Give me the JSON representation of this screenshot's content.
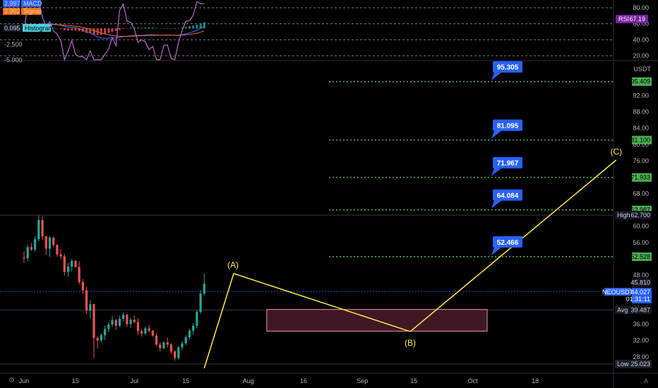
{
  "chart_data": {
    "type": "candlestick",
    "symbol": "NEOUSDT",
    "currency": "USDT",
    "price_axis": {
      "ylim": [
        25.2,
        100.2
      ],
      "ticks": [
        28,
        32,
        36,
        40,
        44,
        48,
        52,
        56,
        60,
        64,
        68,
        72,
        76,
        80,
        84,
        88,
        92
      ]
    },
    "x_axis": {
      "labels": [
        "Jun",
        "15",
        "Jul",
        "15",
        "Aug",
        "16",
        "Sep",
        "15",
        "Oct",
        "18"
      ],
      "label_days": [
        0,
        14,
        30,
        44,
        61,
        76,
        92,
        106,
        122,
        139
      ],
      "xlim": [
        -1,
        173
      ]
    },
    "candles": [
      [
        52.3,
        53.8,
        51.0,
        52.1
      ],
      [
        52.1,
        55.5,
        51.4,
        54.9
      ],
      [
        54.9,
        55.9,
        53.9,
        54.3
      ],
      [
        54.3,
        57.5,
        53.7,
        56.8
      ],
      [
        56.8,
        62.6,
        56.3,
        61.5
      ],
      [
        61.5,
        62.4,
        56.7,
        57.5
      ],
      [
        57.5,
        57.7,
        53.0,
        54.5
      ],
      [
        54.5,
        57.6,
        52.5,
        57.2
      ],
      [
        57.2,
        57.4,
        54.9,
        55.4
      ],
      [
        55.4,
        55.6,
        52.5,
        53.1
      ],
      [
        53.1,
        54.4,
        51.9,
        52.6
      ],
      [
        52.6,
        53.2,
        47.9,
        48.8
      ],
      [
        48.8,
        51.0,
        47.6,
        50.1
      ],
      [
        50.1,
        52.0,
        48.9,
        51.5
      ],
      [
        51.5,
        51.7,
        49.9,
        50.0
      ],
      [
        50.0,
        51.4,
        45.7,
        46.3
      ],
      [
        46.3,
        47.0,
        43.4,
        44.3
      ],
      [
        44.3,
        45.1,
        38.5,
        39.3
      ],
      [
        39.3,
        41.9,
        37.4,
        40.9
      ],
      [
        40.9,
        41.0,
        27.7,
        32.6
      ],
      [
        32.6,
        33.0,
        30.0,
        32.0
      ],
      [
        32.0,
        33.7,
        31.5,
        33.3
      ],
      [
        33.3,
        35.7,
        32.1,
        34.8
      ],
      [
        34.8,
        36.5,
        34.0,
        35.9
      ],
      [
        35.9,
        38.0,
        35.3,
        37.0
      ],
      [
        37.0,
        37.3,
        34.6,
        35.6
      ],
      [
        35.6,
        38.1,
        35.3,
        37.3
      ],
      [
        37.3,
        38.8,
        36.6,
        38.3
      ],
      [
        38.3,
        38.5,
        35.3,
        36.0
      ],
      [
        36.0,
        37.6,
        35.1,
        37.1
      ],
      [
        37.1,
        38.1,
        36.2,
        36.5
      ],
      [
        36.5,
        37.5,
        33.4,
        34.3
      ],
      [
        34.3,
        34.8,
        32.9,
        33.7
      ],
      [
        33.7,
        35.5,
        33.3,
        35.0
      ],
      [
        35.0,
        35.8,
        34.0,
        34.4
      ],
      [
        34.4,
        34.6,
        32.9,
        33.2
      ],
      [
        33.2,
        33.8,
        30.6,
        31.0
      ],
      [
        31.0,
        31.5,
        29.3,
        30.1
      ],
      [
        30.1,
        31.9,
        29.8,
        31.5
      ],
      [
        31.5,
        32.7,
        30.3,
        31.0
      ],
      [
        31.0,
        31.3,
        28.7,
        29.3
      ],
      [
        29.3,
        29.6,
        27.0,
        27.7
      ],
      [
        27.7,
        30.7,
        27.2,
        30.3
      ],
      [
        30.3,
        31.8,
        29.6,
        31.3
      ],
      [
        31.3,
        33.3,
        30.9,
        32.8
      ],
      [
        32.8,
        34.8,
        32.3,
        34.4
      ],
      [
        34.4,
        36.3,
        33.4,
        35.6
      ],
      [
        35.6,
        39.5,
        35.0,
        39.0
      ],
      [
        39.0,
        44.3,
        38.5,
        43.5
      ],
      [
        43.5,
        48.4,
        43.0,
        45.9
      ]
    ],
    "rsi": {
      "label": "RSI",
      "value_label": "67.19",
      "levels": [
        80,
        60,
        40,
        20
      ]
    },
    "macd": {
      "macd_label": "MACD",
      "macd_value": "2.997",
      "signal_label": "Signal",
      "signal_value": "2.902",
      "histogram_label": "Histogram",
      "histogram_value": "0.095",
      "ticks": [
        "-2.500",
        "-5.000"
      ]
    },
    "price_tags": {
      "high": {
        "label": "High",
        "value": "62.700",
        "price": 62.7
      },
      "low": {
        "label": "Low",
        "value": "25.023",
        "price": 25.023
      },
      "avg": {
        "label": "Avg",
        "value": "39.487",
        "price": 39.487
      },
      "prev": {
        "value": "45.810",
        "price": 45.81
      },
      "last": {
        "symbol": "NEOUSDT",
        "value": "44.027",
        "countdown": "01:31:11",
        "price": 44.027
      }
    },
    "target_levels": [
      {
        "price": 95.409,
        "value": "95.409",
        "callout": "95.305"
      },
      {
        "price": 81.1,
        "value": "81.100",
        "callout": "81.095"
      },
      {
        "price": 71.933,
        "value": "71.933",
        "callout": "71.967"
      },
      {
        "price": 63.987,
        "value": "63.987",
        "callout": "64.084"
      },
      {
        "price": 52.528,
        "value": "52.528",
        "callout": "52.466"
      }
    ],
    "wave": [
      {
        "day": 49,
        "price": 25.2,
        "label": ""
      },
      {
        "day": 57,
        "price": 48.4,
        "label": "(A)"
      },
      {
        "day": 105,
        "price": 34.2,
        "label": "(B)"
      },
      {
        "day": 161,
        "price": 76.2,
        "label": "(C)"
      }
    ],
    "zones": [
      {
        "day_start": 132,
        "day_end": 182,
        "price_low": 71.933,
        "price_high": 81.1
      },
      {
        "day_start": 66,
        "day_end": 128,
        "price_low": 34.3,
        "price_high": 39.6
      }
    ]
  },
  "colors": {
    "up": "#26a69a",
    "down": "#ef5350",
    "target_line": "#4caf50",
    "callout": "#2962ff",
    "wave": "#ffeb3b",
    "zone_fill": "#4a1c2c",
    "zone_stroke": "#f48fb1",
    "rsi_tag": "#7b1fa2",
    "macd_tag": "#2962ff",
    "signal_tag": "#ff6d00",
    "hist_tag": "#4dd0e1"
  },
  "footer": {
    "tz_icon": "gear-icon",
    "auto_label": "A"
  }
}
